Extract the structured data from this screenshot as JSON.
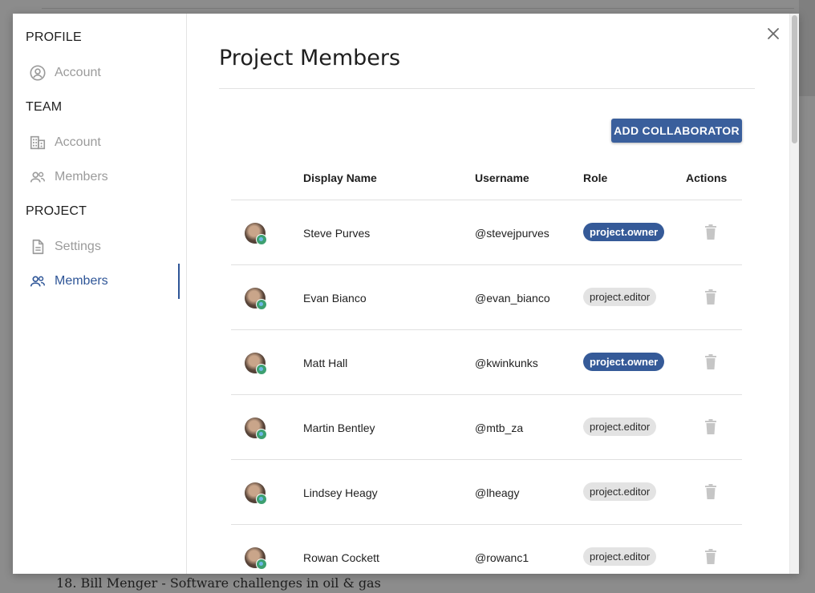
{
  "background": {
    "footer_text": "18. Bill Menger - Software challenges in oil & gas"
  },
  "sidebar": {
    "sections": [
      {
        "title": "PROFILE",
        "items": [
          {
            "label": "Account",
            "icon": "user-circle-icon",
            "active": false
          }
        ]
      },
      {
        "title": "TEAM",
        "items": [
          {
            "label": "Account",
            "icon": "building-icon",
            "active": false
          },
          {
            "label": "Members",
            "icon": "people-icon",
            "active": false
          }
        ]
      },
      {
        "title": "PROJECT",
        "items": [
          {
            "label": "Settings",
            "icon": "document-icon",
            "active": false
          },
          {
            "label": "Members",
            "icon": "people-icon",
            "active": true
          }
        ]
      }
    ]
  },
  "main": {
    "title": "Project Members",
    "add_button_label": "ADD COLLABORATOR",
    "table": {
      "headers": {
        "display_name": "Display Name",
        "username": "Username",
        "role": "Role",
        "actions": "Actions"
      },
      "rows": [
        {
          "display_name": "Steve Purves",
          "username": "@stevejpurves",
          "role": "project.owner"
        },
        {
          "display_name": "Evan Bianco",
          "username": "@evan_bianco",
          "role": "project.editor"
        },
        {
          "display_name": "Matt Hall",
          "username": "@kwinkunks",
          "role": "project.owner"
        },
        {
          "display_name": "Martin Bentley",
          "username": "@mtb_za",
          "role": "project.editor"
        },
        {
          "display_name": "Lindsey Heagy",
          "username": "@lheagy",
          "role": "project.editor"
        },
        {
          "display_name": "Rowan Cockett",
          "username": "@rowanc1",
          "role": "project.editor"
        }
      ]
    }
  },
  "colors": {
    "accent": "#2e5597",
    "owner_chip": "#355a98",
    "editor_chip": "#e3e3e3",
    "inactive_nav": "#9b9b9b"
  },
  "icons": {
    "close": "close-icon",
    "delete": "trash-icon",
    "avatar_badge": "globe-badge-icon"
  }
}
